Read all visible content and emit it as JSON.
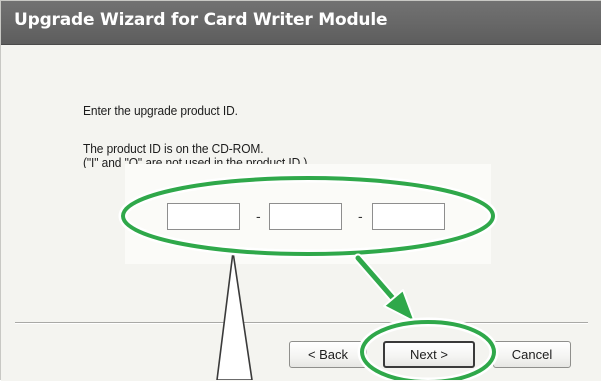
{
  "window": {
    "title": "Upgrade Wizard for Card Writer Module"
  },
  "content": {
    "instruction": "Enter the upgrade product ID.",
    "hint_line1": "The product ID is on the CD-ROM.",
    "hint_line2": "(\"I\" and \"O\" are not used in the product ID.)"
  },
  "product_id": {
    "separator": "-",
    "fields": [
      {
        "value": ""
      },
      {
        "value": ""
      },
      {
        "value": ""
      }
    ]
  },
  "buttons": {
    "back_label": "< Back",
    "next_label": "Next >",
    "cancel_label": "Cancel"
  },
  "annotations": {
    "highlight_color": "#2fa84a",
    "highlight_fill": "#d8efd5",
    "callout_targets": [
      "product-id-fields",
      "next-button"
    ]
  }
}
